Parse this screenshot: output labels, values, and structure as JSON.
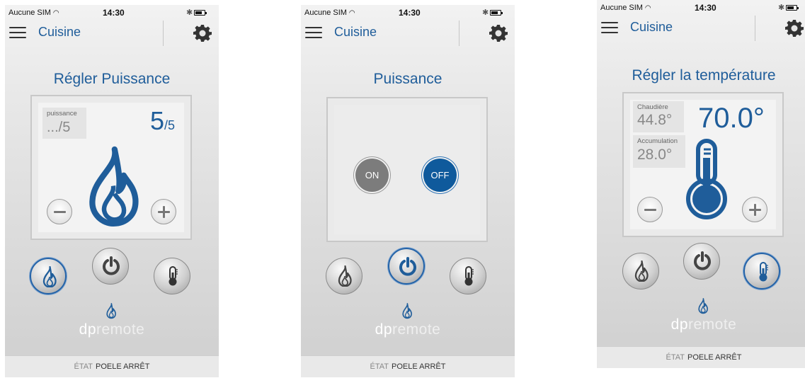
{
  "colors": {
    "accent": "#1f5d9a",
    "on_button": "#7c7c7c",
    "off_button": "#0f5a9c"
  },
  "screens": [
    {
      "status": {
        "carrier": "Aucune SIM",
        "time": "14:30"
      },
      "nav": {
        "title": "Cuisine"
      },
      "page_title": "Régler Puissance",
      "power": {
        "label": "puissance",
        "current": ".../5",
        "value": "5",
        "max": "/5"
      },
      "footer": {
        "state_label": "ÉTAT",
        "state_value": "POELE ARRÊT"
      },
      "active_mode": "flame"
    },
    {
      "status": {
        "carrier": "Aucune SIM",
        "time": "14:30"
      },
      "nav": {
        "title": "Cuisine"
      },
      "page_title": "Puissance",
      "toggle": {
        "on_label": "ON",
        "off_label": "OFF",
        "selected": "OFF"
      },
      "footer": {
        "state_label": "ÉTAT",
        "state_value": "POELE ARRÊT"
      },
      "active_mode": "power"
    },
    {
      "status": {
        "carrier": "Aucune SIM",
        "time": "14:30"
      },
      "nav": {
        "title": "Cuisine"
      },
      "page_title": "Régler la température",
      "chaudiere": {
        "label": "Chaudière",
        "value": "44.8°"
      },
      "accumulation": {
        "label": "Accumulation",
        "value": "28.0°"
      },
      "setpoint": "70.0°",
      "footer": {
        "state_label": "ÉTAT",
        "state_value": "POELE ARRÊT"
      },
      "active_mode": "thermometer"
    }
  ],
  "logo": {
    "part1": "dp",
    "part2": "remote"
  },
  "icons": [
    "menu-icon",
    "gear-icon",
    "flame-icon",
    "power-icon",
    "thermometer-icon",
    "minus-icon",
    "plus-icon",
    "wifi-icon",
    "bluetooth-icon",
    "battery-icon"
  ]
}
